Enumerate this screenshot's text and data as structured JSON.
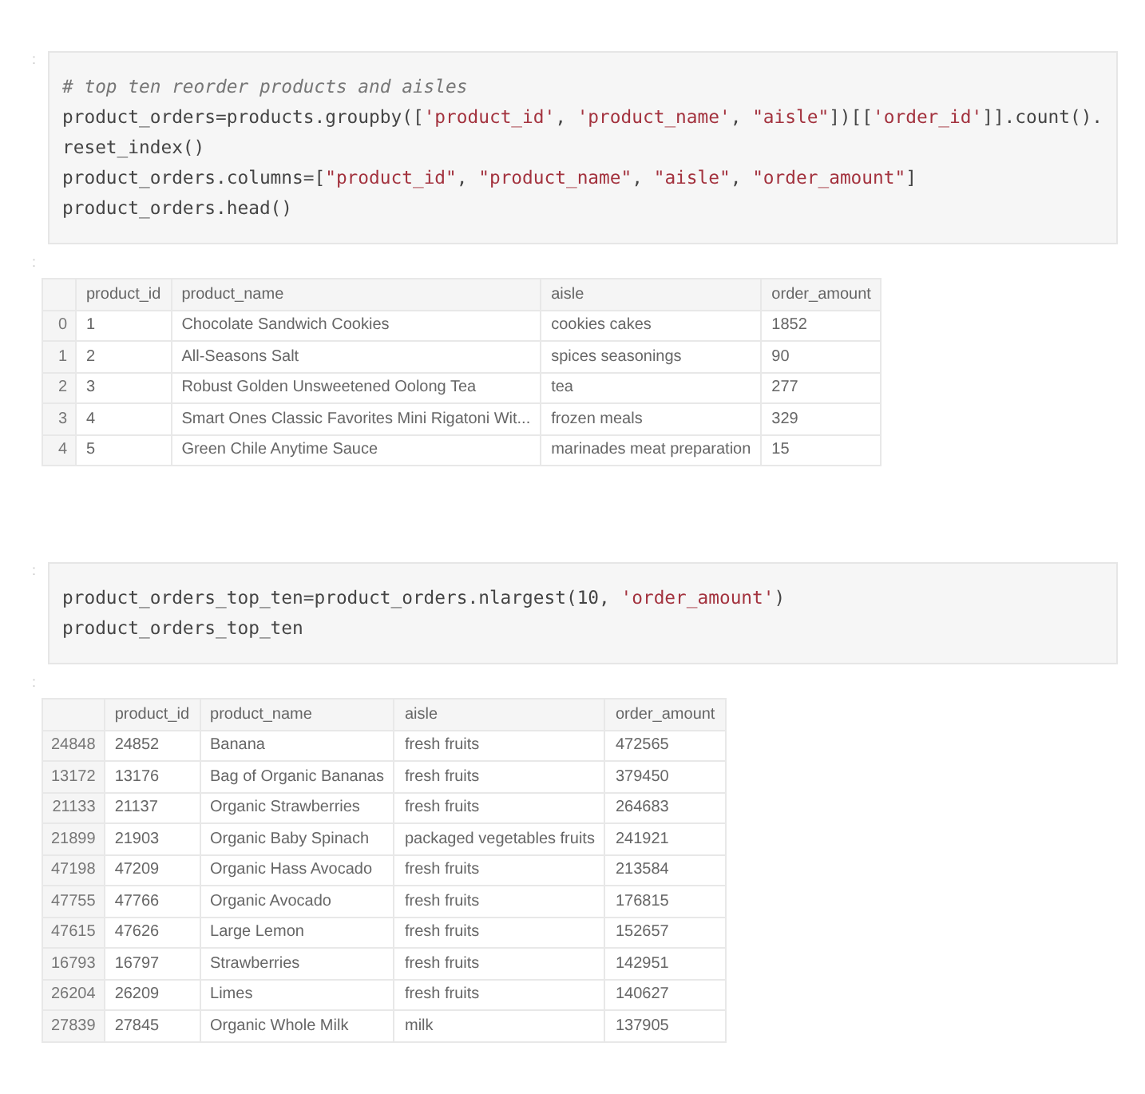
{
  "cells": [
    {
      "prompt": ":",
      "code_lines": [
        [
          {
            "kind": "comment",
            "text": "# top ten reorder products and aisles"
          }
        ],
        [
          {
            "kind": "plain",
            "text": "product_orders=products.groupby(["
          },
          {
            "kind": "string",
            "text": "'product_id'"
          },
          {
            "kind": "plain",
            "text": ", "
          },
          {
            "kind": "string",
            "text": "'product_name'"
          },
          {
            "kind": "plain",
            "text": ", "
          },
          {
            "kind": "string",
            "text": "\"aisle\""
          },
          {
            "kind": "plain",
            "text": "])[["
          },
          {
            "kind": "string",
            "text": "'order_id'"
          },
          {
            "kind": "plain",
            "text": "]].count()."
          }
        ],
        [
          {
            "kind": "plain",
            "text": "reset_index()"
          }
        ],
        [
          {
            "kind": "plain",
            "text": "product_orders.columns=["
          },
          {
            "kind": "string",
            "text": "\"product_id\""
          },
          {
            "kind": "plain",
            "text": ", "
          },
          {
            "kind": "string",
            "text": "\"product_name\""
          },
          {
            "kind": "plain",
            "text": ", "
          },
          {
            "kind": "string",
            "text": "\"aisle\""
          },
          {
            "kind": "plain",
            "text": ", "
          },
          {
            "kind": "string",
            "text": "\"order_amount\""
          },
          {
            "kind": "plain",
            "text": "]"
          }
        ],
        [
          {
            "kind": "plain",
            "text": "product_orders.head()"
          }
        ]
      ],
      "output_prompt": ":",
      "table": {
        "columns": [
          "product_id",
          "product_name",
          "aisle",
          "order_amount"
        ],
        "rows": [
          {
            "index": "0",
            "cells": [
              "1",
              "Chocolate Sandwich Cookies",
              "cookies cakes",
              "1852"
            ]
          },
          {
            "index": "1",
            "cells": [
              "2",
              "All-Seasons Salt",
              "spices seasonings",
              "90"
            ]
          },
          {
            "index": "2",
            "cells": [
              "3",
              "Robust Golden Unsweetened Oolong Tea",
              "tea",
              "277"
            ]
          },
          {
            "index": "3",
            "cells": [
              "4",
              "Smart Ones Classic Favorites Mini Rigatoni Wit...",
              "frozen meals",
              "329"
            ]
          },
          {
            "index": "4",
            "cells": [
              "5",
              "Green Chile Anytime Sauce",
              "marinades meat preparation",
              "15"
            ]
          }
        ]
      }
    },
    {
      "prompt": ":",
      "code_lines": [
        [
          {
            "kind": "plain",
            "text": "product_orders_top_ten=product_orders.nlargest(10, "
          },
          {
            "kind": "string",
            "text": "'order_amount'"
          },
          {
            "kind": "plain",
            "text": ")"
          }
        ],
        [
          {
            "kind": "plain",
            "text": "product_orders_top_ten"
          }
        ]
      ],
      "output_prompt": ":",
      "table": {
        "columns": [
          "product_id",
          "product_name",
          "aisle",
          "order_amount"
        ],
        "rows": [
          {
            "index": "24848",
            "cells": [
              "24852",
              "Banana",
              "fresh fruits",
              "472565"
            ]
          },
          {
            "index": "13172",
            "cells": [
              "13176",
              "Bag of Organic Bananas",
              "fresh fruits",
              "379450"
            ]
          },
          {
            "index": "21133",
            "cells": [
              "21137",
              "Organic Strawberries",
              "fresh fruits",
              "264683"
            ]
          },
          {
            "index": "21899",
            "cells": [
              "21903",
              "Organic Baby Spinach",
              "packaged vegetables fruits",
              "241921"
            ]
          },
          {
            "index": "47198",
            "cells": [
              "47209",
              "Organic Hass Avocado",
              "fresh fruits",
              "213584"
            ]
          },
          {
            "index": "47755",
            "cells": [
              "47766",
              "Organic Avocado",
              "fresh fruits",
              "176815"
            ]
          },
          {
            "index": "47615",
            "cells": [
              "47626",
              "Large Lemon",
              "fresh fruits",
              "152657"
            ]
          },
          {
            "index": "16793",
            "cells": [
              "16797",
              "Strawberries",
              "fresh fruits",
              "142951"
            ]
          },
          {
            "index": "26204",
            "cells": [
              "26209",
              "Limes",
              "fresh fruits",
              "140627"
            ]
          },
          {
            "index": "27839",
            "cells": [
              "27845",
              "Organic Whole Milk",
              "milk",
              "137905"
            ]
          }
        ]
      }
    }
  ]
}
